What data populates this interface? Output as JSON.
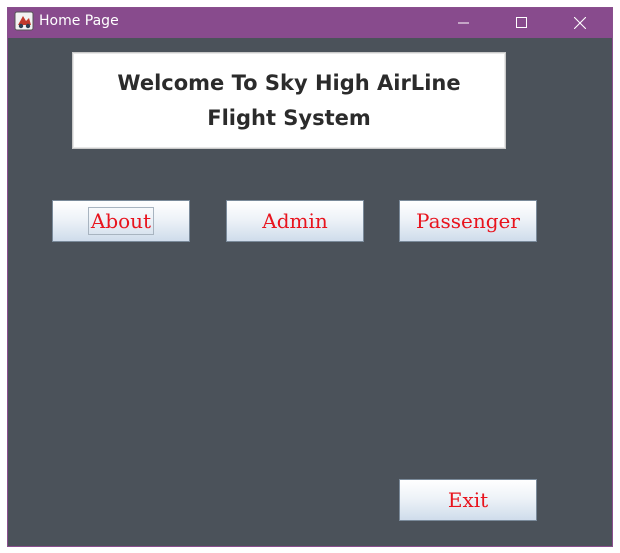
{
  "window": {
    "title": "Home Page",
    "controls": {
      "minimize_icon": "minimize-icon",
      "maximize_icon": "maximize-icon",
      "close_icon": "close-icon"
    },
    "titlebar_color": "#884b8d",
    "background_color": "#4b525a"
  },
  "header": {
    "line1": "Welcome To Sky High AirLine",
    "line2": "Flight System"
  },
  "buttons": {
    "about": "About",
    "admin": "Admin",
    "passenger": "Passenger",
    "exit": "Exit"
  },
  "button_text_color": "#e8141e"
}
